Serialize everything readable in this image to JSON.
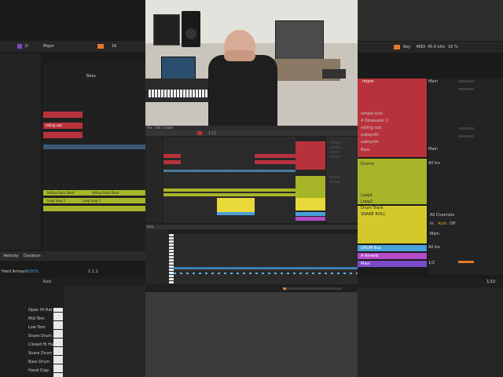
{
  "left_panel": {
    "scale_label": "Major",
    "scale_letter": "D",
    "toolbar_value": "16",
    "arrangement_row_label": "Bass",
    "clip_name": "rolling sub",
    "clip_bar": "Hilltop Rock Beat",
    "clip_bar_repeat": "Hilltop Rock Beat",
    "clip_bar_2": "Loop loop 1",
    "clip_bar_2b": "Loop loop 1",
    "bottom_tabs": [
      "Velocity",
      "Duration"
    ],
    "bottom_value": "100%",
    "track_label": "Hard Amount",
    "position": "1.1.1",
    "drum_header": "Kick",
    "drum_pads": [
      "Open Hi Hat",
      "Mid Tom",
      "Low Tom",
      "Snare Drum",
      "Closed Hi Hat",
      "Snare Drum",
      "Bass Drum",
      "Hand Clap"
    ],
    "drum_numbers": [
      "46",
      "47",
      "45",
      "40",
      "42",
      "38",
      "36",
      "39"
    ]
  },
  "center": {
    "menu_items": [
      "File",
      "Edit",
      "Create",
      "View",
      "Options",
      "Help"
    ],
    "track_names": [
      "simple kick",
      "4 Obsession",
      "rolling sub",
      "subsynth",
      "subsynth",
      "Hilltop Rock",
      "Hand",
      "Snare",
      "Loop"
    ],
    "time_display": "1.1.1",
    "piano_roll_label": "Kick"
  },
  "right_panel": {
    "key_label": "Key",
    "midi_label": "MIDI",
    "cpu_value": "45.0 kHz",
    "cpu_pct": "16 %",
    "track_header": "Impro",
    "tracks": [
      {
        "name": "simple kick",
        "color": "#b8323c"
      },
      {
        "name": "4 Obsession 2",
        "color": "#b8323c"
      },
      {
        "name": "rolling sub",
        "color": "#b8323c"
      },
      {
        "name": "subsynth",
        "color": "#b8323c"
      },
      {
        "name": "subsynth",
        "color": "#b8323c"
      },
      {
        "name": "Bass",
        "color": "#b8323c"
      },
      {
        "name": "Drums",
        "color": "#a7b528"
      },
      {
        "name": "Loop1",
        "color": "#a7b528"
      },
      {
        "name": "Loop2",
        "color": "#a7b528"
      },
      {
        "name": "Drum Track",
        "color": "#a7b528"
      },
      {
        "name": "SNARE ROLL",
        "color": "#d4c92a"
      },
      {
        "name": "DRUM Bus",
        "color": "#4aa0d8"
      },
      {
        "name": "A Reverb",
        "color": "#b34ac9"
      },
      {
        "name": "Main",
        "color": "#7b4ac9"
      }
    ],
    "routing": [
      "Main",
      "Main",
      "All Ins",
      "All Channels",
      "Main",
      "All Ins",
      "1/2"
    ],
    "monitor": [
      "In",
      "Auto",
      "Off"
    ],
    "page_counter": "1/10"
  }
}
